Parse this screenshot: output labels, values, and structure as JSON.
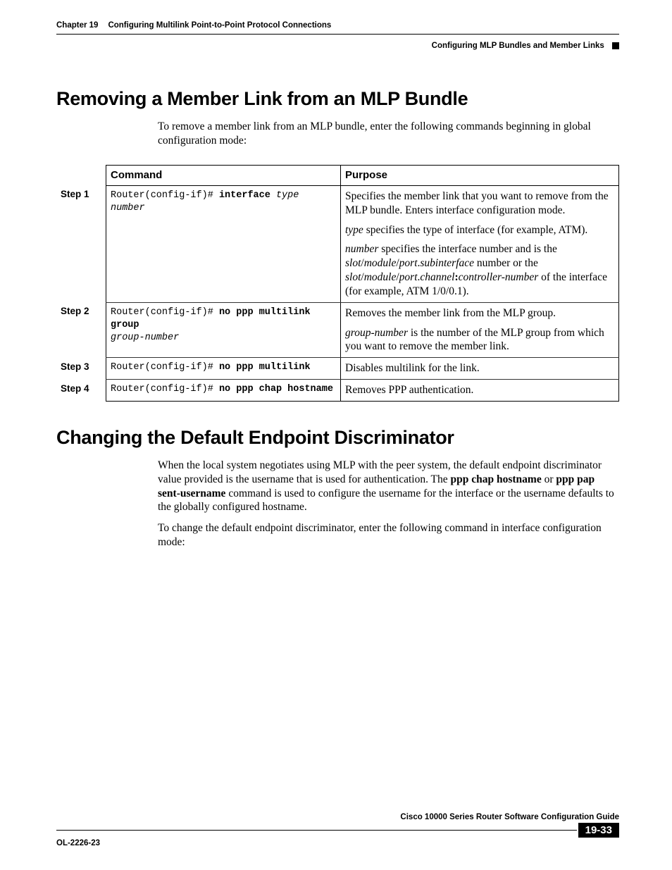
{
  "header": {
    "chapter_label": "Chapter 19",
    "chapter_title": "Configuring Multilink Point-to-Point Protocol Connections",
    "section_path": "Configuring MLP Bundles and Member Links"
  },
  "section1": {
    "heading": "Removing a Member Link from an MLP Bundle",
    "intro": "To remove a member link from an MLP bundle, enter the following commands beginning in global configuration mode:"
  },
  "table": {
    "headers": {
      "command": "Command",
      "purpose": "Purpose"
    },
    "rows": [
      {
        "step": "Step 1",
        "cmd_prefix": "Router(config-if)# ",
        "cmd_bold": "interface",
        "cmd_italic": " type number",
        "purpose_parts": {
          "p1_a": "Specifies the member link that you want to remove from the MLP bundle. Enters interface configuration mode.",
          "p2_it": "type",
          "p2_rest": " specifies the type of interface (for example, ATM).",
          "p3_it1": "number",
          "p3_mid1": " specifies the interface number and is the ",
          "p3_it2": "slot",
          "p3_sep1": "/",
          "p3_it3": "module",
          "p3_sep2": "/",
          "p3_it4": "port",
          "p3_dot": ".",
          "p3_it5": "subinterface",
          "p3_mid2": " number or the ",
          "p3_it6": "slot",
          "p3_sep3": "/",
          "p3_it7": "module",
          "p3_sep4": "/",
          "p3_it8": "port",
          "p3_dot2": ".",
          "p3_it9": "channel",
          "p3_bcolon": ":",
          "p3_it10": "controller-number",
          "p3_end": " of the interface (for example, ATM 1/0/0.1)."
        }
      },
      {
        "step": "Step 2",
        "cmd_prefix": "Router(config-if)# ",
        "cmd_bold": "no ppp multilink group",
        "cmd_italic_line2": "group-number",
        "purpose_parts": {
          "p1": "Removes the member link from the MLP group.",
          "p2_it": "group-number",
          "p2_rest": " is the number of the MLP group from which you want to remove the member link."
        }
      },
      {
        "step": "Step 3",
        "cmd_prefix": "Router(config-if)# ",
        "cmd_bold": "no ppp multilink",
        "purpose": "Disables multilink for the link."
      },
      {
        "step": "Step 4",
        "cmd_prefix": "Router(config-if)# ",
        "cmd_bold": "no ppp chap hostname",
        "purpose": "Removes PPP authentication."
      }
    ]
  },
  "section2": {
    "heading": "Changing the Default Endpoint Discriminator",
    "para1_a": "When the local system negotiates using MLP with the peer system, the default endpoint discriminator value provided is the username that is used for authentication. The ",
    "para1_b1": "ppp chap hostname",
    "para1_mid": " or ",
    "para1_b2": "ppp pap sent-username",
    "para1_c": " command is used to configure the username for the interface or the username defaults to the globally configured hostname.",
    "para2": "To change the default endpoint discriminator, enter the following command in interface configuration mode:"
  },
  "footer": {
    "guide_title": "Cisco 10000 Series Router Software Configuration Guide",
    "doc_id": "OL-2226-23",
    "page_num": "19-33"
  }
}
